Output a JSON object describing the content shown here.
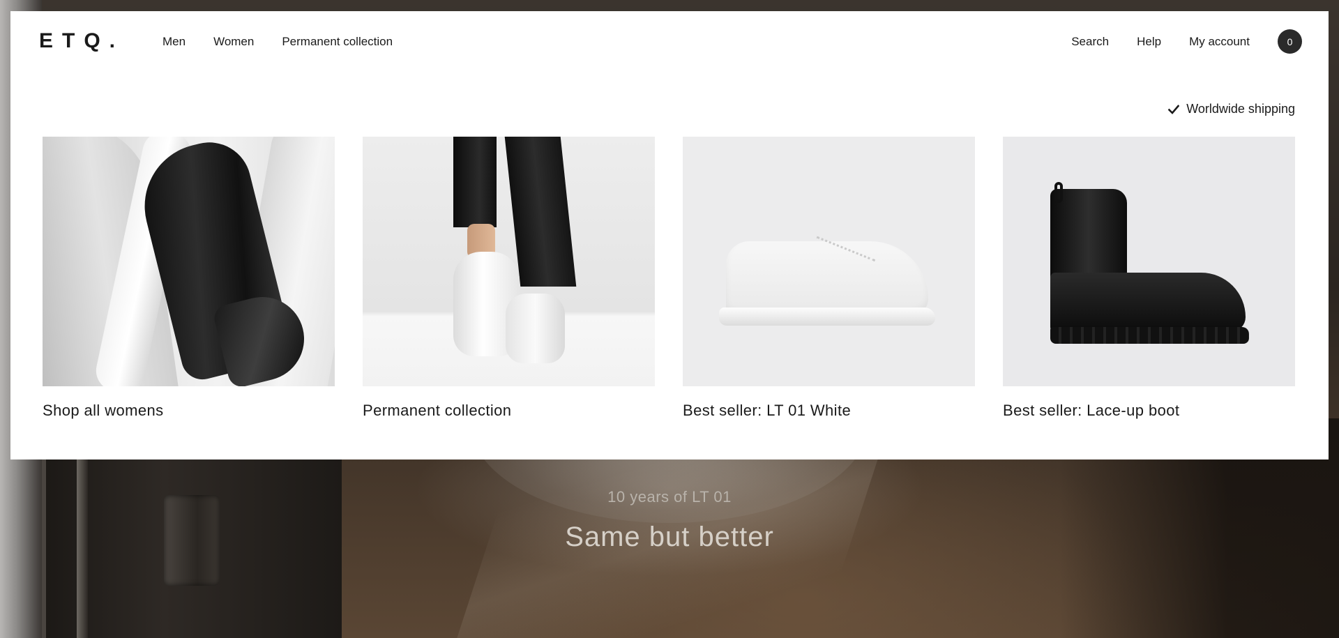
{
  "header": {
    "logo": "ETQ.",
    "nav_left": [
      "Men",
      "Women",
      "Permanent collection"
    ],
    "nav_right": [
      "Search",
      "Help",
      "My account"
    ],
    "cart_count": "0"
  },
  "shipping": {
    "icon": "check-icon",
    "label": "Worldwide shipping"
  },
  "cards": [
    {
      "label": "Shop all womens"
    },
    {
      "label": "Permanent collection"
    },
    {
      "label": "Best seller: LT 01 White"
    },
    {
      "label": "Best seller: Lace-up boot"
    }
  ],
  "hero": {
    "subtitle": "10 years of LT 01",
    "title": "Same but better"
  }
}
